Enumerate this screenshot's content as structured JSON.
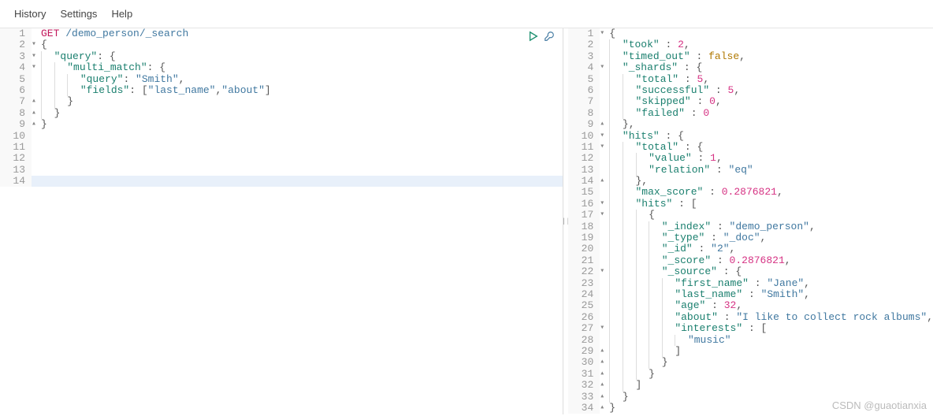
{
  "menu": {
    "items": [
      "History",
      "Settings",
      "Help"
    ]
  },
  "actions": {
    "run": "run",
    "wrench": "wrench"
  },
  "leftEditor": {
    "lines": [
      {
        "n": 1,
        "fold": "",
        "seg": [
          [
            "method",
            "GET"
          ],
          [
            "pun",
            " "
          ],
          [
            "path",
            "/demo_person/_search"
          ]
        ]
      },
      {
        "n": 2,
        "fold": "▾",
        "seg": [
          [
            "pun",
            "{"
          ]
        ]
      },
      {
        "n": 3,
        "fold": "▾",
        "seg": [
          [
            "pun",
            "  "
          ],
          [
            "key",
            "\"query\""
          ],
          [
            "pun",
            ": {"
          ]
        ]
      },
      {
        "n": 4,
        "fold": "▾",
        "seg": [
          [
            "pun",
            "    "
          ],
          [
            "key",
            "\"multi_match\""
          ],
          [
            "pun",
            ": {"
          ]
        ]
      },
      {
        "n": 5,
        "fold": "",
        "seg": [
          [
            "pun",
            "      "
          ],
          [
            "key",
            "\"query\""
          ],
          [
            "pun",
            ": "
          ],
          [
            "str",
            "\"Smith\""
          ],
          [
            "pun",
            ","
          ]
        ]
      },
      {
        "n": 6,
        "fold": "",
        "seg": [
          [
            "pun",
            "      "
          ],
          [
            "key",
            "\"fields\""
          ],
          [
            "pun",
            ": ["
          ],
          [
            "str",
            "\"last_name\""
          ],
          [
            "pun",
            ","
          ],
          [
            "str",
            "\"about\""
          ],
          [
            "pun",
            "]"
          ]
        ]
      },
      {
        "n": 7,
        "fold": "▴",
        "seg": [
          [
            "pun",
            "    }"
          ]
        ]
      },
      {
        "n": 8,
        "fold": "▴",
        "seg": [
          [
            "pun",
            "  }"
          ]
        ]
      },
      {
        "n": 9,
        "fold": "▴",
        "seg": [
          [
            "pun",
            "}"
          ]
        ]
      },
      {
        "n": 10,
        "fold": "",
        "seg": []
      },
      {
        "n": 11,
        "fold": "",
        "seg": []
      },
      {
        "n": 12,
        "fold": "",
        "seg": []
      },
      {
        "n": 13,
        "fold": "",
        "seg": []
      },
      {
        "n": 14,
        "fold": "",
        "seg": [],
        "hl": true
      }
    ]
  },
  "rightEditor": {
    "lines": [
      {
        "n": 1,
        "fold": "▾",
        "seg": [
          [
            "pun",
            "{"
          ]
        ]
      },
      {
        "n": 2,
        "fold": "",
        "seg": [
          [
            "pun",
            "  "
          ],
          [
            "key",
            "\"took\""
          ],
          [
            "pun",
            " : "
          ],
          [
            "num",
            "2"
          ],
          [
            "pun",
            ","
          ]
        ]
      },
      {
        "n": 3,
        "fold": "",
        "seg": [
          [
            "pun",
            "  "
          ],
          [
            "key",
            "\"timed_out\""
          ],
          [
            "pun",
            " : "
          ],
          [
            "bool",
            "false"
          ],
          [
            "pun",
            ","
          ]
        ]
      },
      {
        "n": 4,
        "fold": "▾",
        "seg": [
          [
            "pun",
            "  "
          ],
          [
            "key",
            "\"_shards\""
          ],
          [
            "pun",
            " : {"
          ]
        ]
      },
      {
        "n": 5,
        "fold": "",
        "seg": [
          [
            "pun",
            "    "
          ],
          [
            "key",
            "\"total\""
          ],
          [
            "pun",
            " : "
          ],
          [
            "num",
            "5"
          ],
          [
            "pun",
            ","
          ]
        ]
      },
      {
        "n": 6,
        "fold": "",
        "seg": [
          [
            "pun",
            "    "
          ],
          [
            "key",
            "\"successful\""
          ],
          [
            "pun",
            " : "
          ],
          [
            "num",
            "5"
          ],
          [
            "pun",
            ","
          ]
        ]
      },
      {
        "n": 7,
        "fold": "",
        "seg": [
          [
            "pun",
            "    "
          ],
          [
            "key",
            "\"skipped\""
          ],
          [
            "pun",
            " : "
          ],
          [
            "num",
            "0"
          ],
          [
            "pun",
            ","
          ]
        ]
      },
      {
        "n": 8,
        "fold": "",
        "seg": [
          [
            "pun",
            "    "
          ],
          [
            "key",
            "\"failed\""
          ],
          [
            "pun",
            " : "
          ],
          [
            "num",
            "0"
          ]
        ]
      },
      {
        "n": 9,
        "fold": "▴",
        "seg": [
          [
            "pun",
            "  },"
          ]
        ]
      },
      {
        "n": 10,
        "fold": "▾",
        "seg": [
          [
            "pun",
            "  "
          ],
          [
            "key",
            "\"hits\""
          ],
          [
            "pun",
            " : {"
          ]
        ]
      },
      {
        "n": 11,
        "fold": "▾",
        "seg": [
          [
            "pun",
            "    "
          ],
          [
            "key",
            "\"total\""
          ],
          [
            "pun",
            " : {"
          ]
        ]
      },
      {
        "n": 12,
        "fold": "",
        "seg": [
          [
            "pun",
            "      "
          ],
          [
            "key",
            "\"value\""
          ],
          [
            "pun",
            " : "
          ],
          [
            "num",
            "1"
          ],
          [
            "pun",
            ","
          ]
        ]
      },
      {
        "n": 13,
        "fold": "",
        "seg": [
          [
            "pun",
            "      "
          ],
          [
            "key",
            "\"relation\""
          ],
          [
            "pun",
            " : "
          ],
          [
            "str",
            "\"eq\""
          ]
        ]
      },
      {
        "n": 14,
        "fold": "▴",
        "seg": [
          [
            "pun",
            "    },"
          ]
        ]
      },
      {
        "n": 15,
        "fold": "",
        "seg": [
          [
            "pun",
            "    "
          ],
          [
            "key",
            "\"max_score\""
          ],
          [
            "pun",
            " : "
          ],
          [
            "num",
            "0.2876821"
          ],
          [
            "pun",
            ","
          ]
        ]
      },
      {
        "n": 16,
        "fold": "▾",
        "seg": [
          [
            "pun",
            "    "
          ],
          [
            "key",
            "\"hits\""
          ],
          [
            "pun",
            " : ["
          ]
        ]
      },
      {
        "n": 17,
        "fold": "▾",
        "seg": [
          [
            "pun",
            "      {"
          ]
        ]
      },
      {
        "n": 18,
        "fold": "",
        "seg": [
          [
            "pun",
            "        "
          ],
          [
            "key",
            "\"_index\""
          ],
          [
            "pun",
            " : "
          ],
          [
            "str",
            "\"demo_person\""
          ],
          [
            "pun",
            ","
          ]
        ]
      },
      {
        "n": 19,
        "fold": "",
        "seg": [
          [
            "pun",
            "        "
          ],
          [
            "key",
            "\"_type\""
          ],
          [
            "pun",
            " : "
          ],
          [
            "str",
            "\"_doc\""
          ],
          [
            "pun",
            ","
          ]
        ]
      },
      {
        "n": 20,
        "fold": "",
        "seg": [
          [
            "pun",
            "        "
          ],
          [
            "key",
            "\"_id\""
          ],
          [
            "pun",
            " : "
          ],
          [
            "str",
            "\"2\""
          ],
          [
            "pun",
            ","
          ]
        ]
      },
      {
        "n": 21,
        "fold": "",
        "seg": [
          [
            "pun",
            "        "
          ],
          [
            "key",
            "\"_score\""
          ],
          [
            "pun",
            " : "
          ],
          [
            "num",
            "0.2876821"
          ],
          [
            "pun",
            ","
          ]
        ]
      },
      {
        "n": 22,
        "fold": "▾",
        "seg": [
          [
            "pun",
            "        "
          ],
          [
            "key",
            "\"_source\""
          ],
          [
            "pun",
            " : {"
          ]
        ]
      },
      {
        "n": 23,
        "fold": "",
        "seg": [
          [
            "pun",
            "          "
          ],
          [
            "key",
            "\"first_name\""
          ],
          [
            "pun",
            " : "
          ],
          [
            "str",
            "\"Jane\""
          ],
          [
            "pun",
            ","
          ]
        ]
      },
      {
        "n": 24,
        "fold": "",
        "seg": [
          [
            "pun",
            "          "
          ],
          [
            "key",
            "\"last_name\""
          ],
          [
            "pun",
            " : "
          ],
          [
            "str",
            "\"Smith\""
          ],
          [
            "pun",
            ","
          ]
        ]
      },
      {
        "n": 25,
        "fold": "",
        "seg": [
          [
            "pun",
            "          "
          ],
          [
            "key",
            "\"age\""
          ],
          [
            "pun",
            " : "
          ],
          [
            "num",
            "32"
          ],
          [
            "pun",
            ","
          ]
        ]
      },
      {
        "n": 26,
        "fold": "",
        "seg": [
          [
            "pun",
            "          "
          ],
          [
            "key",
            "\"about\""
          ],
          [
            "pun",
            " : "
          ],
          [
            "str",
            "\"I like to collect rock albums\""
          ],
          [
            "pun",
            ","
          ]
        ]
      },
      {
        "n": 27,
        "fold": "▾",
        "seg": [
          [
            "pun",
            "          "
          ],
          [
            "key",
            "\"interests\""
          ],
          [
            "pun",
            " : ["
          ]
        ]
      },
      {
        "n": 28,
        "fold": "",
        "seg": [
          [
            "pun",
            "            "
          ],
          [
            "str",
            "\"music\""
          ]
        ]
      },
      {
        "n": 29,
        "fold": "▴",
        "seg": [
          [
            "pun",
            "          ]"
          ]
        ]
      },
      {
        "n": 30,
        "fold": "▴",
        "seg": [
          [
            "pun",
            "        }"
          ]
        ]
      },
      {
        "n": 31,
        "fold": "▴",
        "seg": [
          [
            "pun",
            "      }"
          ]
        ]
      },
      {
        "n": 32,
        "fold": "▴",
        "seg": [
          [
            "pun",
            "    ]"
          ]
        ]
      },
      {
        "n": 33,
        "fold": "▴",
        "seg": [
          [
            "pun",
            "  }"
          ]
        ]
      },
      {
        "n": 34,
        "fold": "▴",
        "seg": [
          [
            "pun",
            "}"
          ]
        ]
      }
    ]
  },
  "watermark": "CSDN @guaotianxia"
}
